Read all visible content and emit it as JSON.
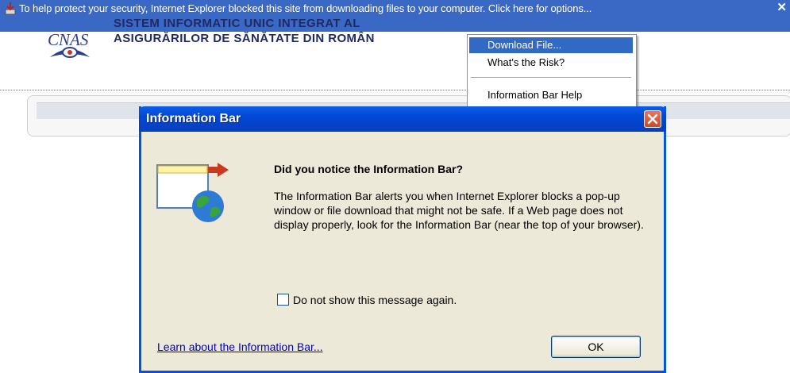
{
  "infobar": {
    "text": "To help protect your security, Internet Explorer blocked this site from downloading files to your computer. Click here for options...",
    "close_glyph": "✕",
    "icon": "blocked-download-icon"
  },
  "page": {
    "logo_text": "CNAS",
    "title_line1": "SISTEM INFORMATIC UNIC INTEGRAT AL",
    "title_line2": "ASIGURĂRILOR DE SĂNĂTATE DIN ROMÂN"
  },
  "menu": {
    "items": [
      {
        "label": "Download File...",
        "selected": true
      },
      {
        "label": "What's the Risk?",
        "selected": false
      },
      {
        "label": "Information Bar Help",
        "selected": false
      }
    ]
  },
  "dialog": {
    "title": "Information Bar",
    "heading": "Did you notice the Information Bar?",
    "body": "The Information Bar alerts you when Internet Explorer blocks a pop-up window or file download that might not be safe. If a Web page does not display properly, look for the Information Bar (near the top of your browser).",
    "checkbox_label": "Do not show this message again.",
    "checkbox_checked": false,
    "learn_link": "Learn about the Information Bar...",
    "ok_label": "OK"
  },
  "colors": {
    "infobar_bg": "#3a69c5",
    "titlebar": "#0148d6",
    "dialog_bg": "#ece9d8",
    "menu_selected": "#316ac5",
    "link": "#0000cc"
  }
}
